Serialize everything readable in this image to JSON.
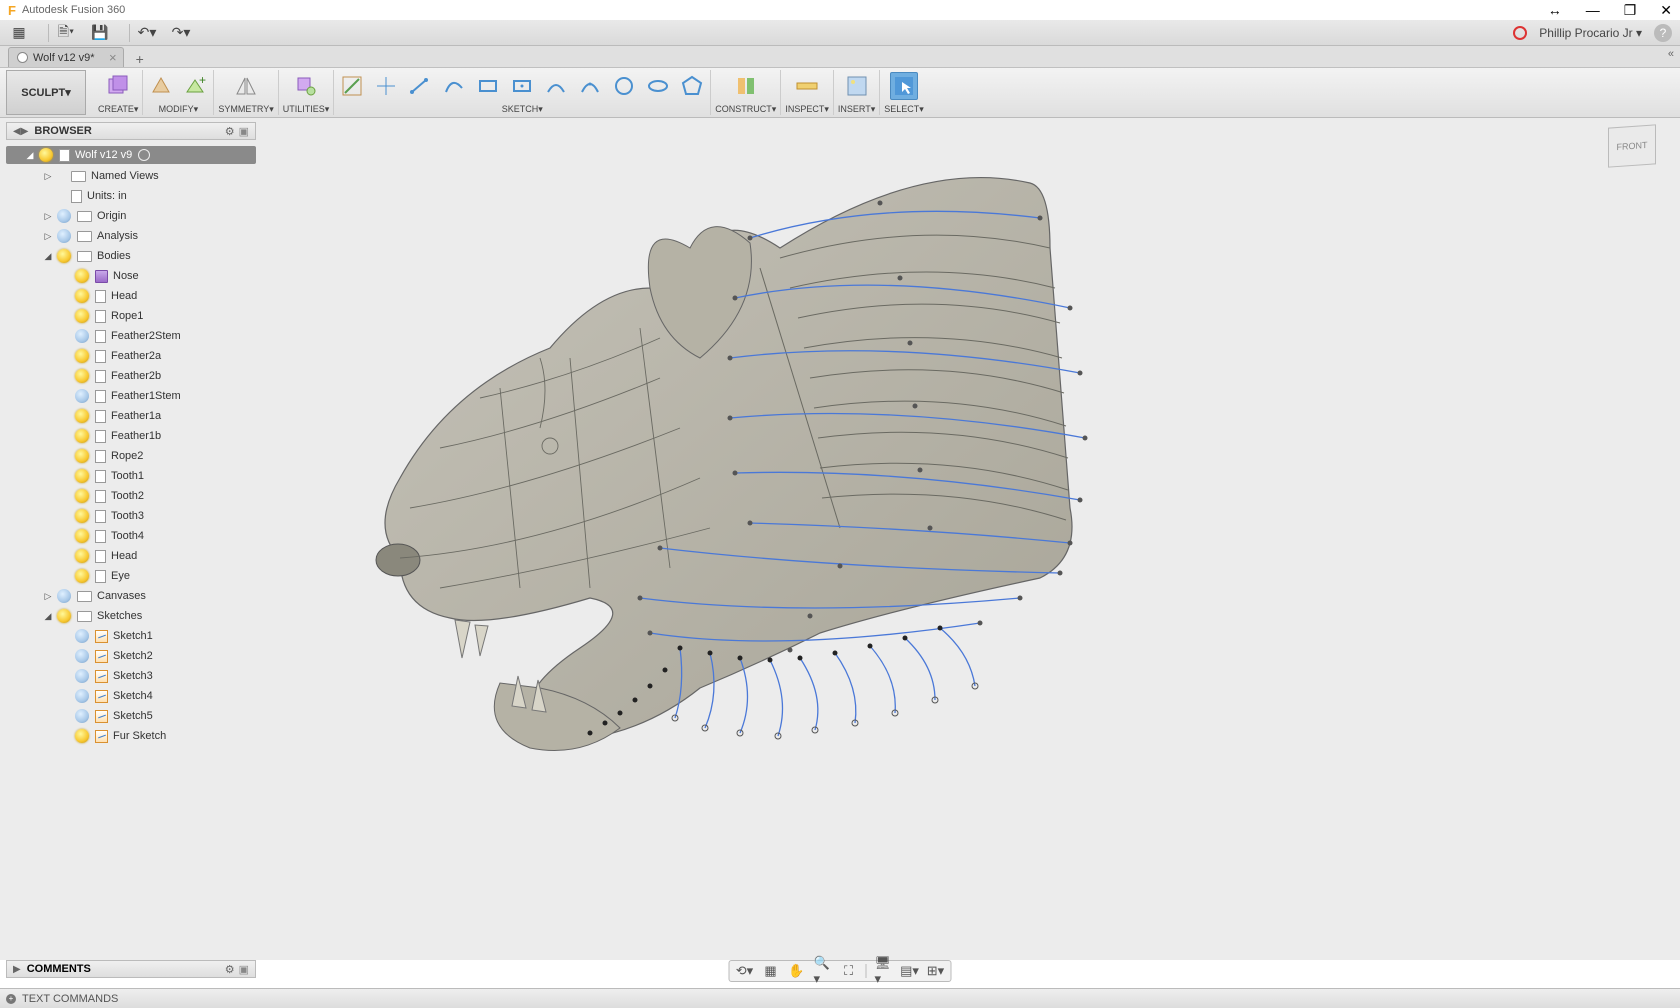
{
  "titleBar": {
    "appName": "Autodesk Fusion 360"
  },
  "menuBar": {
    "userName": "Phillip Procario Jr"
  },
  "tabs": [
    {
      "label": "Wolf v12 v9*"
    }
  ],
  "ribbon": {
    "workspace": "SCULPT",
    "groups": {
      "create": "CREATE",
      "modify": "MODIFY",
      "symmetry": "SYMMETRY",
      "utilities": "UTILITIES",
      "sketch": "SKETCH",
      "construct": "CONSTRUCT",
      "inspect": "INSPECT",
      "insert": "INSERT",
      "select": "SELECT"
    }
  },
  "viewCube": {
    "face": "FRONT"
  },
  "browser": {
    "title": "BROWSER",
    "root": "Wolf v12 v9",
    "namedViews": "Named Views",
    "units": "Units: in",
    "origin": "Origin",
    "analysis": "Analysis",
    "bodiesFolder": "Bodies",
    "bodies": [
      "Nose",
      "Head",
      "Rope1",
      "Feather2Stem",
      "Feather2a",
      "Feather2b",
      "Feather1Stem",
      "Feather1a",
      "Feather1b",
      "Rope2",
      "Tooth1",
      "Tooth2",
      "Tooth3",
      "Tooth4",
      "Head",
      "Eye"
    ],
    "canvases": "Canvases",
    "sketchesFolder": "Sketches",
    "sketches": [
      "Sketch1",
      "Sketch2",
      "Sketch3",
      "Sketch4",
      "Sketch5",
      "Fur Sketch"
    ]
  },
  "commentsBar": {
    "title": "COMMENTS"
  },
  "textCmd": {
    "label": "TEXT COMMANDS"
  }
}
